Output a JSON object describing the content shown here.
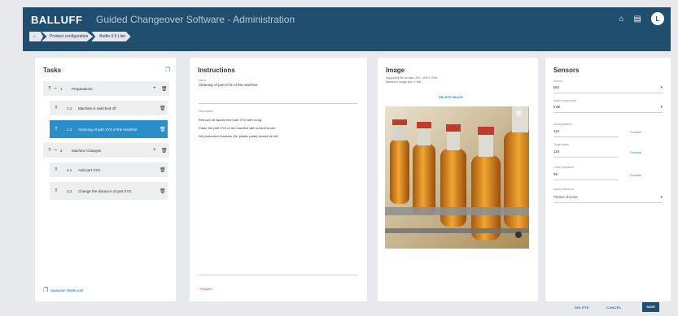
{
  "header": {
    "brand": "BALLUFF",
    "title": "Guided Changeover Software - Administration",
    "avatar_initial": "L",
    "breadcrumbs": [
      "Product configuration",
      "Bottle 0.5 Liter"
    ]
  },
  "tasks": {
    "title": "Tasks",
    "items": [
      {
        "num": "1",
        "label": "Preparations"
      },
      {
        "num": "1.1",
        "label": "Machine is switched off"
      },
      {
        "num": "1.2",
        "label": "Cleaning of part XYZ of the machine"
      },
      {
        "num": "2",
        "label": "Machine Changes"
      },
      {
        "num": "2.1",
        "label": "Add part XYZ"
      },
      {
        "num": "2.2",
        "label": "Change the distance of part XYZ"
      }
    ],
    "footer_link": "MANAGE TEMPLATE"
  },
  "instructions": {
    "title": "Instructions",
    "name_label": "Name",
    "name_value": "Cleaning of part XYZ of the machine",
    "desc_label": "Description",
    "lines": [
      "Remove all liquids from part XYZ with a rag.",
      "Clean the part XYZ of the machine with a hand brush.",
      "No production residues (fix. plastic parts) should be left."
    ],
    "required": "* Required"
  },
  "image": {
    "title": "Image",
    "meta1": "Supported file formats: JPG, JPEG, PNG",
    "meta2": "Maximum image size: 1 MB",
    "link": "DELETE IMAGE"
  },
  "sensors": {
    "title": "Sensors",
    "fields": [
      {
        "label": "Sensor",
        "value": "BIS"
      },
      {
        "label": "Select component",
        "value": "Inlet"
      },
      {
        "label": "Actual position",
        "value": "110",
        "action": "Position"
      },
      {
        "label": "Target value",
        "value": "110",
        "action": "Position"
      },
      {
        "label": "Lower tolerance",
        "value": "95",
        "action": "Position"
      },
      {
        "label": "Upper tolerance",
        "value": "Please choose"
      }
    ]
  },
  "footer": {
    "delete": "DELETE",
    "cancel": "CANCEL",
    "save": "SAVE"
  },
  "colors": {
    "header": "#1f4e6e",
    "accent": "#2a8ec9"
  }
}
